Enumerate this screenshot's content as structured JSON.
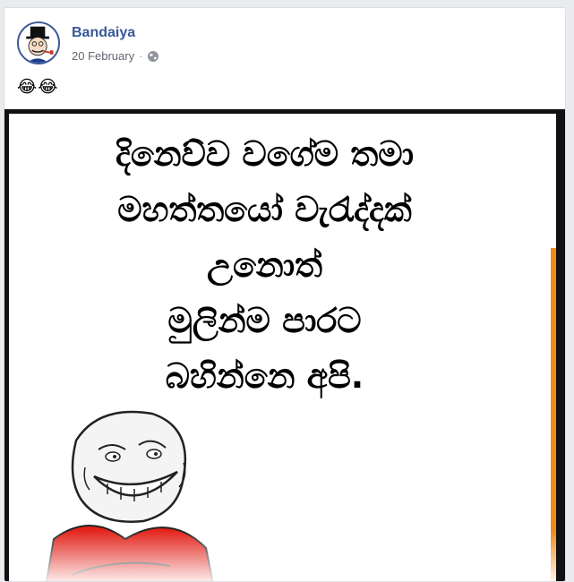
{
  "post": {
    "author": "Bandaiya",
    "date": "20 February",
    "separator": "·",
    "privacy_icon": "globe-icon",
    "text": "😂😂"
  },
  "meme": {
    "lines": [
      "දිනෙව්ව වගේම තමා",
      "මහත්තයෝ වැරැද්දක්",
      "උනොත්",
      "මුලින්ම පාරට",
      "බහින්නෙ අපි."
    ]
  },
  "colors": {
    "author_link": "#385898",
    "accent_bar": "#f08a1a",
    "shirt": "#e2231a"
  }
}
